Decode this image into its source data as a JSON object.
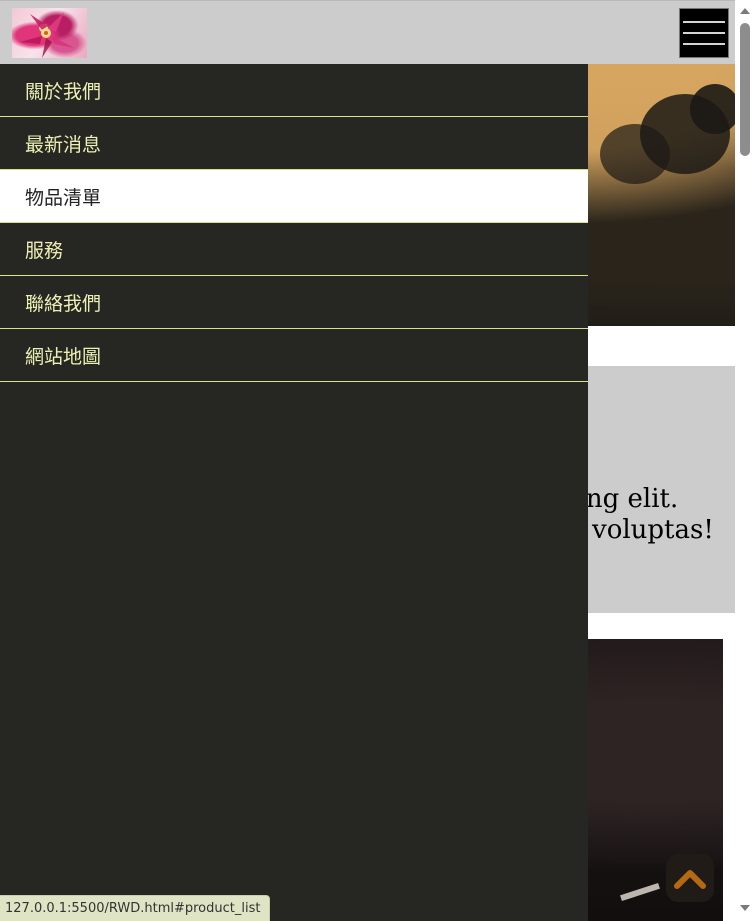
{
  "nav": {
    "items": [
      {
        "label": "關於我們",
        "active": false
      },
      {
        "label": "最新消息",
        "active": false
      },
      {
        "label": "物品清單",
        "active": true
      },
      {
        "label": "服務",
        "active": false
      },
      {
        "label": "聯絡我們",
        "active": false
      },
      {
        "label": "網站地圖",
        "active": false
      }
    ]
  },
  "content": {
    "line1_visible": "cing elit.",
    "line2_visible": "voluptas!"
  },
  "status_bar": {
    "url": "127.0.0.1:5500/RWD.html#product_list"
  },
  "icons": {
    "menu": "hamburger-menu-icon",
    "back_to_top": "chevron-up-icon",
    "logo": "flower-logo"
  },
  "colors": {
    "header_bg": "#cccccc",
    "menu_bg": "#262722",
    "menu_text": "#ecf0b4",
    "menu_divider": "#d7e28a",
    "active_bg": "#ffffff",
    "back_to_top_arrow": "#b36a12"
  }
}
